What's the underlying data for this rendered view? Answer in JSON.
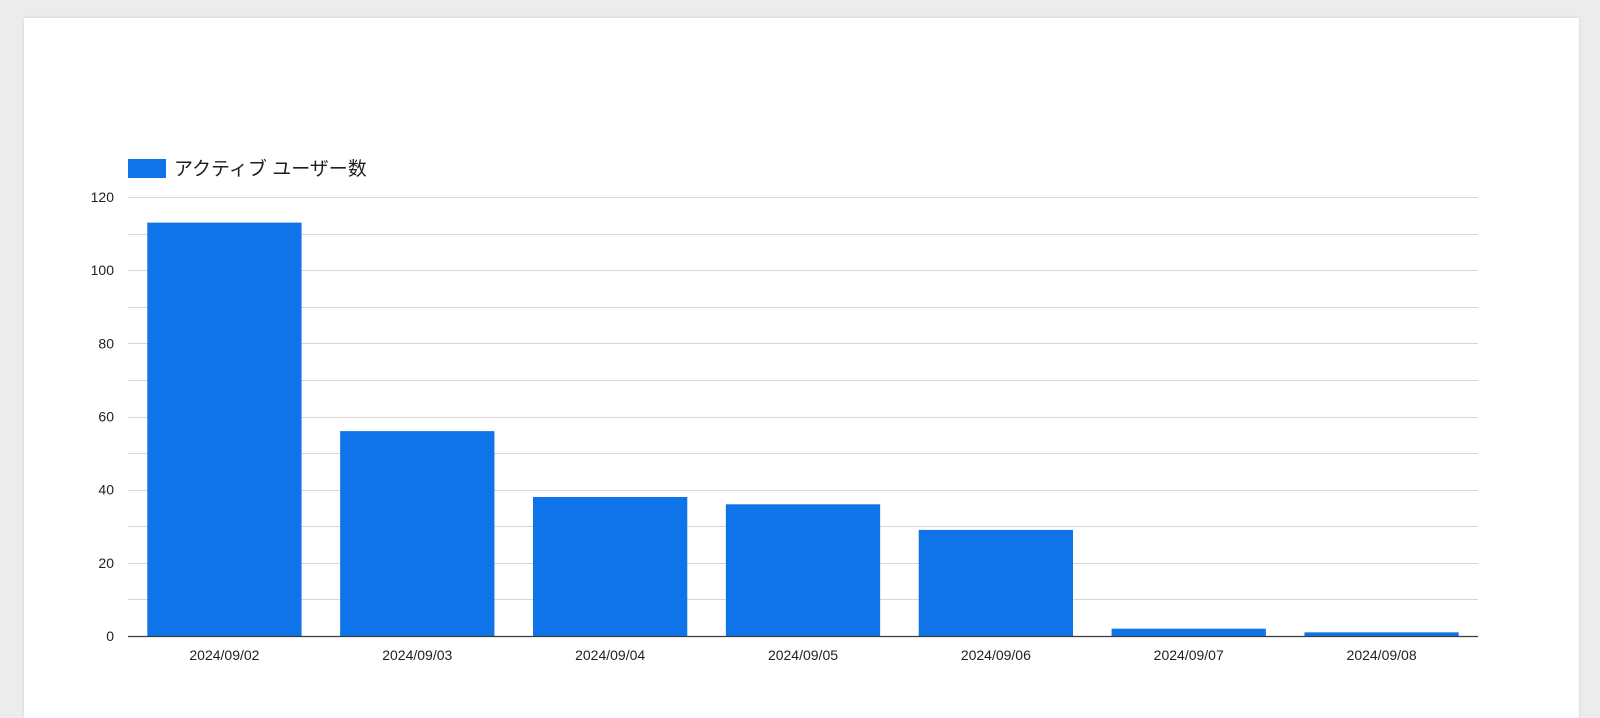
{
  "colors": {
    "bar": "#0f74e9",
    "grid": "#d6d6d6",
    "axis": "#3c3c3c",
    "background": "#ececec",
    "card": "#ffffff"
  },
  "chart_data": {
    "type": "bar",
    "title": "",
    "xlabel": "",
    "ylabel": "",
    "categories": [
      "2024/09/02",
      "2024/09/03",
      "2024/09/04",
      "2024/09/05",
      "2024/09/06",
      "2024/09/07",
      "2024/09/08"
    ],
    "series": [
      {
        "name": "アクティブ ユーザー数",
        "values": [
          113,
          56,
          38,
          36,
          29,
          2,
          1
        ]
      }
    ],
    "ylim": [
      0,
      120
    ],
    "yticks": [
      0,
      20,
      40,
      60,
      80,
      100,
      120
    ],
    "ytick_labels": [
      "0",
      "20",
      "40",
      "60",
      "80",
      "100",
      "120"
    ],
    "minor_gridlines": true,
    "grid": true,
    "legend": "top-left"
  }
}
